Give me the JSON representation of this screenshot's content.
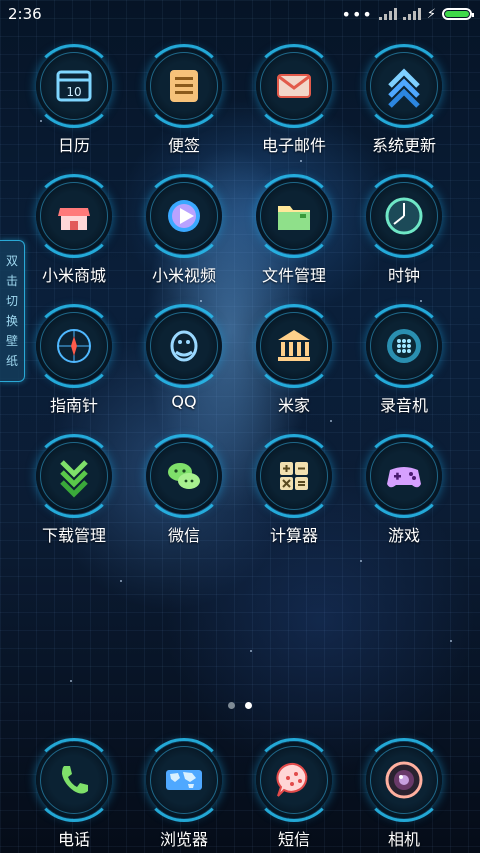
{
  "status_bar": {
    "time": "2:36",
    "more": "•••"
  },
  "side_tab": {
    "chars": [
      "双",
      "击",
      "切",
      "换",
      "壁",
      "纸"
    ]
  },
  "apps": [
    {
      "label": "日历"
    },
    {
      "label": "便签"
    },
    {
      "label": "电子邮件"
    },
    {
      "label": "系统更新"
    },
    {
      "label": "小米商城"
    },
    {
      "label": "小米视频"
    },
    {
      "label": "文件管理"
    },
    {
      "label": "时钟"
    },
    {
      "label": "指南针"
    },
    {
      "label": "QQ"
    },
    {
      "label": "米家"
    },
    {
      "label": "录音机"
    },
    {
      "label": "下载管理"
    },
    {
      "label": "微信"
    },
    {
      "label": "计算器"
    },
    {
      "label": "游戏"
    }
  ],
  "dock": [
    {
      "label": "电话"
    },
    {
      "label": "浏览器"
    },
    {
      "label": "短信"
    },
    {
      "label": "相机"
    }
  ],
  "pages": {
    "count": 2,
    "current": 2
  },
  "colors": {
    "battery": "#3fd94a",
    "ring": "#28bef0"
  }
}
